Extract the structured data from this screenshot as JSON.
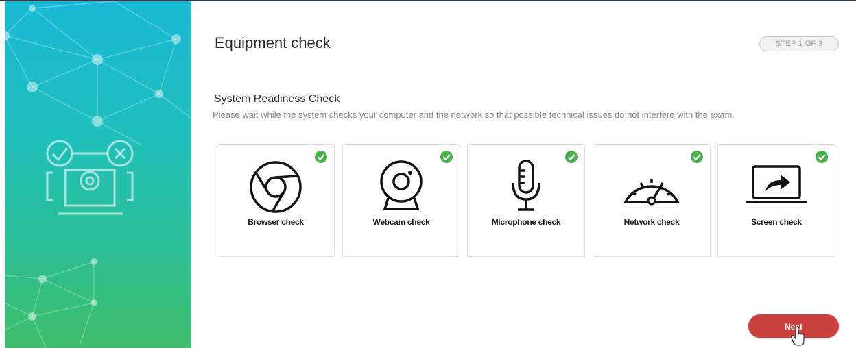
{
  "header": {
    "title": "Equipment check",
    "step_label": "STEP 1 OF 3"
  },
  "readiness": {
    "title": "System Readiness Check",
    "description": "Please wait while the system checks your computer and the network so that possible technical issues do not interfere with the exam."
  },
  "checks": [
    {
      "label": "Browser check",
      "icon": "chrome-icon",
      "status": "passed"
    },
    {
      "label": "Webcam check",
      "icon": "webcam-icon",
      "status": "passed"
    },
    {
      "label": "Microphone check",
      "icon": "microphone-icon",
      "status": "passed"
    },
    {
      "label": "Network check",
      "icon": "speedometer-icon",
      "status": "passed"
    },
    {
      "label": "Screen check",
      "icon": "screen-share-icon",
      "status": "passed"
    }
  ],
  "footer": {
    "next_label": "Next"
  },
  "colors": {
    "accent_button": "#c9403f",
    "check_green": "#4caf50",
    "sidebar_top": "#19b8d6",
    "sidebar_bottom": "#3fbd6a"
  }
}
